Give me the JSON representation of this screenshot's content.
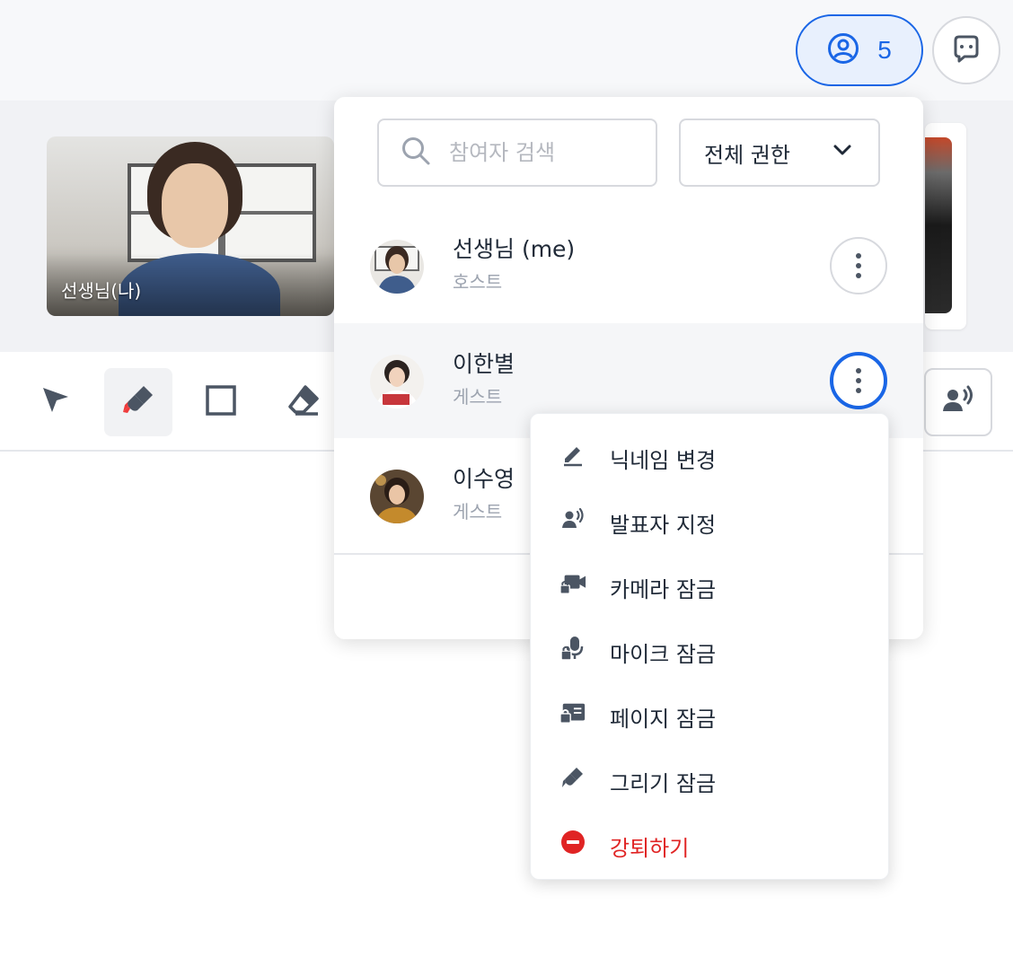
{
  "header": {
    "participants_count": "5"
  },
  "video": {
    "tile_label": "선생님(나)"
  },
  "panel": {
    "search_placeholder": "참여자 검색",
    "permission_filter": "전체 권한",
    "participants": [
      {
        "name": "선생님 (me)",
        "role": "호스트"
      },
      {
        "name": "이한별",
        "role": "게스트"
      },
      {
        "name": "이수영",
        "role": "게스트"
      }
    ]
  },
  "menu": {
    "items": [
      {
        "label": "닉네임 변경",
        "icon": "pencil-icon"
      },
      {
        "label": "발표자 지정",
        "icon": "presenter-icon"
      },
      {
        "label": "카메라 잠금",
        "icon": "camera-lock-icon"
      },
      {
        "label": "마이크 잠금",
        "icon": "mic-lock-icon"
      },
      {
        "label": "페이지 잠금",
        "icon": "page-lock-icon"
      },
      {
        "label": "그리기 잠금",
        "icon": "draw-lock-icon"
      },
      {
        "label": "강퇴하기",
        "icon": "kick-icon"
      }
    ]
  },
  "colors": {
    "accent": "#1a66e6",
    "danger": "#e02424"
  }
}
